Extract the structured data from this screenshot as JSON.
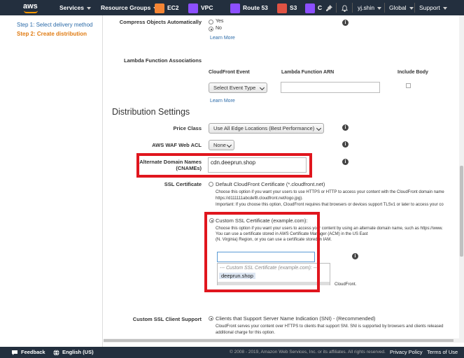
{
  "nav": {
    "brand": "aws",
    "services": "Services",
    "resource_groups": "Resource Groups",
    "ec2": "EC2",
    "vpc": "VPC",
    "route53": "Route 53",
    "s3": "S3",
    "c": "C",
    "user": "yj.shin",
    "region": "Global",
    "support": "Support"
  },
  "sidebar": {
    "steps": [
      "Step 1: Select delivery method",
      "Step 2: Create distribution"
    ]
  },
  "compress": {
    "label": "Compress Objects Automatically",
    "options": [
      "Yes",
      "No"
    ],
    "selected": "No",
    "learn_more": "Learn More"
  },
  "lambda": {
    "label": "Lambda Function Associations",
    "col_event": "CloudFront Event",
    "col_arn": "Lambda Function ARN",
    "col_include_body": "Include Body",
    "event_select": "Select Event Type",
    "arn_value": "",
    "learn_more": "Learn More"
  },
  "distribution": {
    "title": "Distribution Settings",
    "price_class_label": "Price Class",
    "price_class_value": "Use All Edge Locations (Best Performance)",
    "waf_label": "AWS WAF Web ACL",
    "waf_value": "None",
    "cname_label_1": "Alternate Domain Names",
    "cname_label_2": "(CNAMEs)",
    "cname_value": "cdn.deeprun.shop"
  },
  "ssl": {
    "label": "SSL Certificate",
    "default_option": "Default CloudFront Certificate (*.cloudfront.net)",
    "default_desc_1": "Choose this option if you want your users to use HTTPS or HTTP to access your content with the CloudFront domain name",
    "default_desc_2": "https://d111111abcdef8.cloudfront.net/logo.jpg).",
    "default_desc_3": "Important: If you choose this option, CloudFront requires that browsers or devices support TLSv1 or later to access your co",
    "custom_option": "Custom SSL Certificate (example.com):",
    "custom_desc_1": "Choose this option if you want your users to access your content by using an alternate domain name, such as https://www.",
    "custom_desc_2": "You can use a certificate stored in AWS Certificate Manager (ACM) in the US East",
    "custom_desc_3": "(N. Virginia) Region, or you can use a certificate stored in IAM.",
    "custom_input_value": "",
    "dropdown_header": "--- Custom SSL Certificate (example.com): ---",
    "dropdown_item": "deeprun.shop",
    "behind_text": "CloudFront."
  },
  "client_support": {
    "label": "Custom SSL Client Support",
    "option": "Clients that Support Server Name Indication (SNI) - (Recommended)",
    "desc_1": "CloudFront serves your content over HTTPS to clients that support SNI. SNI is supported by browsers and clients released",
    "desc_2": "additional charge for this option."
  },
  "footer": {
    "feedback": "Feedback",
    "language": "English (US)",
    "copyright": "© 2008 - 2019, Amazon Web Services, Inc. or its affiliates. All rights reserved.",
    "privacy": "Privacy Policy",
    "terms": "Terms of Use"
  },
  "colors": {
    "nav_bg": "#232f3e",
    "accent_orange": "#ff9900",
    "link_blue": "#2a6aa8",
    "highlight_red": "#e0161e",
    "step_active": "#e07b12"
  }
}
